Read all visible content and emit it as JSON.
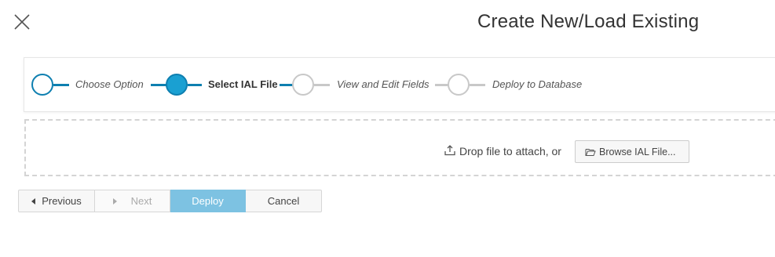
{
  "dialog": {
    "title": "Create New/Load Existing",
    "close_icon": "close-icon"
  },
  "wizard": {
    "steps": [
      {
        "label": "Choose Option",
        "state": "completed"
      },
      {
        "label": "Select IAL File",
        "state": "current"
      },
      {
        "label": "View and Edit Fields",
        "state": "pending"
      },
      {
        "label": "Deploy to Database",
        "state": "pending"
      }
    ]
  },
  "dropzone": {
    "icon": "upload-icon",
    "text": "Drop file to attach, or",
    "browse_label": "Browse IAL File...",
    "browse_icon": "folder-icon"
  },
  "footer": {
    "previous_label": "Previous",
    "next_label": "Next",
    "deploy_label": "Deploy",
    "cancel_label": "Cancel"
  },
  "colors": {
    "accent": "#0e7fb0",
    "accent_fill": "#1aa0d2",
    "deploy_bg": "#7dc2e2",
    "inactive": "#c8c8c8"
  }
}
